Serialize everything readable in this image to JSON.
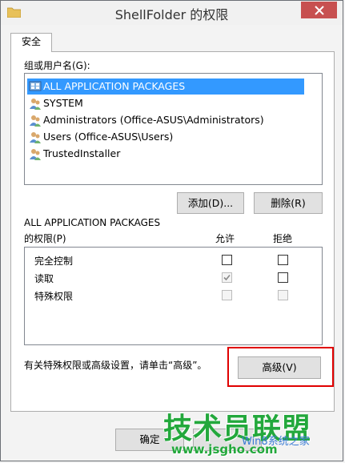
{
  "window": {
    "title": "ShellFolder 的权限"
  },
  "tab": {
    "label": "安全"
  },
  "users": {
    "label": "组或用户名(G):",
    "items": [
      {
        "label": "ALL APPLICATION PACKAGES",
        "icon": "group-icon"
      },
      {
        "label": "SYSTEM",
        "icon": "users-icon"
      },
      {
        "label": "Administrators (Office-ASUS\\Administrators)",
        "icon": "users-icon"
      },
      {
        "label": "Users (Office-ASUS\\Users)",
        "icon": "users-icon"
      },
      {
        "label": "TrustedInstaller",
        "icon": "users-icon"
      }
    ],
    "selected_index": 0,
    "add_label": "添加(D)...",
    "remove_label": "删除(R)"
  },
  "permissions": {
    "heading": "ALL APPLICATION PACKAGES",
    "sublabel": "的权限(P)",
    "allow_header": "允许",
    "deny_header": "拒绝",
    "rows": [
      {
        "label": "完全控制",
        "allow": false,
        "allow_disabled": false,
        "deny": false,
        "deny_disabled": false
      },
      {
        "label": "读取",
        "allow": true,
        "allow_disabled": true,
        "deny": false,
        "deny_disabled": false
      },
      {
        "label": "特殊权限",
        "allow": false,
        "allow_disabled": true,
        "deny": false,
        "deny_disabled": true
      }
    ]
  },
  "advanced": {
    "note": "有关特殊权限或高级设置，请单击“高级”。",
    "button_label": "高级(V)"
  },
  "footer": {
    "ok_label": "确定"
  },
  "watermark": {
    "text": "技术员联盟",
    "url": "www.jsgho.com",
    "brand": "Win8系统之家"
  },
  "colors": {
    "selection": "#3399ff",
    "highlight": "#e00000",
    "close": "#c75050",
    "watermark": "#23a83c"
  }
}
